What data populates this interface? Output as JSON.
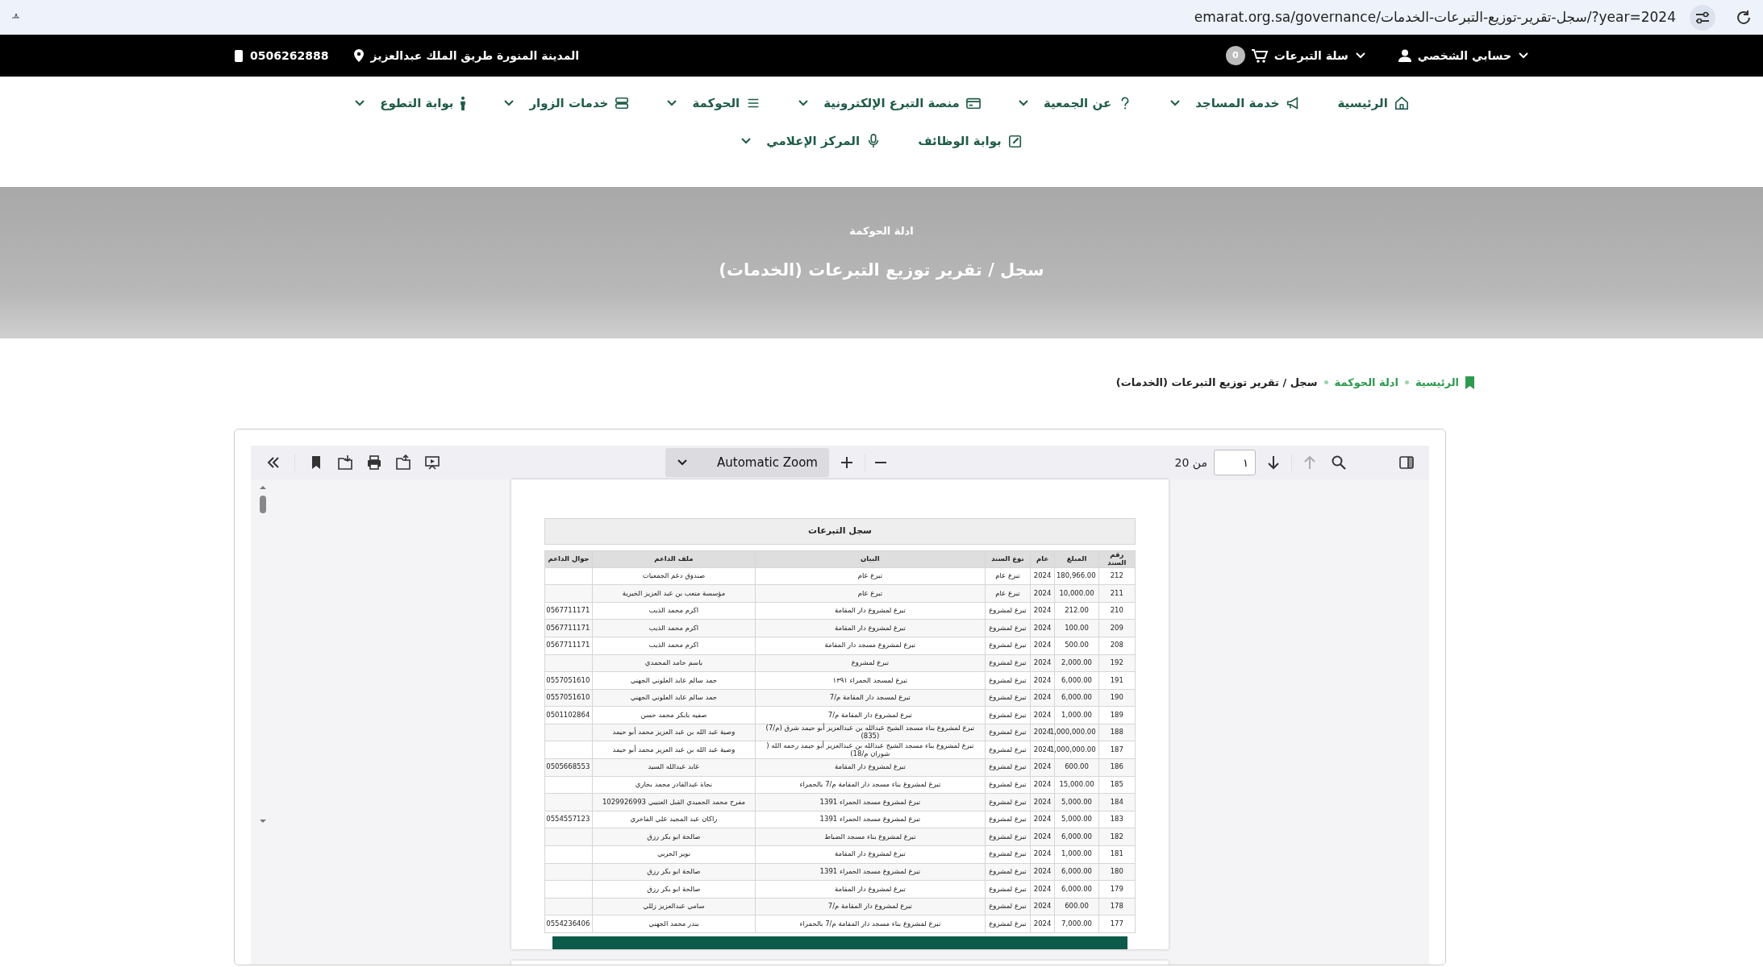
{
  "browser": {
    "url": "emarat.org.sa/governance/سجل-تقرير-توزيع-التبرعات-الخدمات/?year=2024"
  },
  "topbar": {
    "phone": "0506262888",
    "address": "المدينة المنورة طريق الملك عبدالعزيز",
    "cart_count": "0",
    "cart_label": "سلة التبرعات",
    "account_label": "حسابي الشخصي"
  },
  "nav": {
    "rows": [
      [
        {
          "label": "الرئيسية",
          "has_dropdown": false
        },
        {
          "label": "خدمة المساجد",
          "has_dropdown": true
        },
        {
          "label": "عن الجمعية",
          "has_dropdown": true
        },
        {
          "label": "منصة التبرع الإلكترونية",
          "has_dropdown": true
        },
        {
          "label": "الحوكمة",
          "has_dropdown": true
        },
        {
          "label": "خدمات الزوار",
          "has_dropdown": true
        },
        {
          "label": "بوابة التطوع",
          "has_dropdown": true
        }
      ],
      [
        {
          "label": "بوابة الوظائف",
          "has_dropdown": false
        },
        {
          "label": "المركز الإعلامي",
          "has_dropdown": true
        }
      ]
    ]
  },
  "hero": {
    "subtitle": "ادلة الحوكمة",
    "title": "سجل / تقرير توزيع التبرعات (الخدمات)"
  },
  "breadcrumb": [
    {
      "label": "الرئيسية",
      "kind": "link"
    },
    {
      "label": "ادلة الحوكمة",
      "kind": "link"
    },
    {
      "label": "سجل / تقرير توزيع التبرعات (الخدمات)",
      "kind": "current"
    }
  ],
  "viewer": {
    "toolbar": {
      "zoom": "Automatic Zoom",
      "page": "١",
      "page_count": "من 20",
      "previous_disabled": true
    },
    "document": {
      "title": "سجل التبرعات",
      "columns": [
        "رقم السند",
        "المبلغ",
        "عام",
        "نوع السند",
        "البيان",
        "ملف الداعم",
        "جوال الداعم"
      ],
      "rows": [
        [
          "212",
          "180,966.00",
          "2024",
          "تبرع عام",
          "تبرع عام",
          "صندوق دعم الجمعيات",
          ""
        ],
        [
          "211",
          "10,000.00",
          "2024",
          "تبرع عام",
          "تبرع عام",
          "مؤسسة متعب بن عبد العزيز الخيرية",
          ""
        ],
        [
          "210",
          "212.00",
          "2024",
          "تبرع لمشروع",
          "تبرع لمشروع دار المقامة",
          "اكرم محمد الذيب",
          "0567711171"
        ],
        [
          "209",
          "100.00",
          "2024",
          "تبرع لمشروع",
          "تبرع لمشروع دار المقامة",
          "اكرم محمد الذيب",
          "0567711171"
        ],
        [
          "208",
          "500.00",
          "2024",
          "تبرع لمشروع",
          "تبرع لمشروع مسجد دار المقامة",
          "اكرم محمد الذيب",
          "0567711171"
        ],
        [
          "192",
          "2,000.00",
          "2024",
          "تبرع لمشروع",
          "تبرع لمشروع",
          "باسم حامد المحمدي",
          ""
        ],
        [
          "191",
          "6,000.00",
          "2024",
          "تبرع لمشروع",
          "تبرع لمسجد الحمراء ١٣٩١",
          "حمد سالم عايد العلوني الجهني",
          "0557051610"
        ],
        [
          "190",
          "6,000.00",
          "2024",
          "تبرع لمشروع",
          "تبرع لمسجد دار المقامة م/7",
          "حمد سالم عايد العلوني الجهني",
          "0557051610"
        ],
        [
          "189",
          "1,000.00",
          "2024",
          "تبرع لمشروع",
          "تبرع لمشروع دار المقامة م/7",
          "صفيه بابكر محمد حسن",
          "0501102864"
        ],
        [
          "188",
          "1,000,000.00",
          "2024",
          "تبرع لمشروع",
          "تبرع لمشروع بناء مسجد الشيخ عبدالله بن عبدالعزيز أبو حيمد شرق (م/7) (835)",
          "وصية عبد الله بن عبد العزيز محمد أبو حيمد",
          ""
        ],
        [
          "187",
          "1,000,000.00",
          "2024",
          "تبرع لمشروع",
          "تبرع لمشروع بناء مسجد الشيخ عبدالله بن عبدالعزيز أبو حيمد رحمه الله ( شوران م/18)",
          "وصية عبد الله بن عبد العزيز محمد أبو حيمد",
          ""
        ],
        [
          "186",
          "600.00",
          "2024",
          "تبرع لمشروع",
          "تبرع لمشروع دار المقامة",
          "عابد عبدالله السيد",
          "0505668553"
        ],
        [
          "185",
          "15,000.00",
          "2024",
          "تبرع لمشروع",
          "تبرع لمشروع بناء مسجد دار المقامة م/7 بالحمراء",
          "نجاة عبدالقادر محمد بخاري",
          ""
        ],
        [
          "184",
          "5,000.00",
          "2024",
          "تبرع لمشروع",
          "تبرع لمشروع مسجد الحمراء 1391",
          "مفرح محمد الحميدي القبل العتيبي 1029926993",
          ""
        ],
        [
          "183",
          "5,000.00",
          "2024",
          "تبرع لمشروع",
          "تبرع لمشروع مسجد الحمراء 1391",
          "راكان عبد المجيد علي الفاخري",
          "0554557123"
        ],
        [
          "182",
          "6,000.00",
          "2024",
          "تبرع لمشروع",
          "تبرع لمشروع بناء مسجد الضباط",
          "صالحة ابو بكر رزق",
          ""
        ],
        [
          "181",
          "1,000.00",
          "2024",
          "تبرع لمشروع",
          "تبرع لمشروع دار المقامة",
          "نوير الحربي",
          ""
        ],
        [
          "180",
          "6,000.00",
          "2024",
          "تبرع لمشروع",
          "تبرع لمشروع مسجد الحمراء 1391",
          "صالحة ابو بكر رزق",
          ""
        ],
        [
          "179",
          "6,000.00",
          "2024",
          "تبرع لمشروع",
          "تبرع لمشروع دار المقامة",
          "صالحة ابو بكر رزق",
          ""
        ],
        [
          "178",
          "600.00",
          "2024",
          "تبرع لمشروع",
          "تبرع لمشروع دار المقامة م/7",
          "سامي عبدالعزيز زللي",
          ""
        ],
        [
          "177",
          "7,000.00",
          "2024",
          "تبرع لمشروع",
          "تبرع لمشروع بناء مسجد دار المقامة م/7 بالحمراء",
          "بندر محمد الجهني",
          "0554236406"
        ]
      ]
    }
  }
}
